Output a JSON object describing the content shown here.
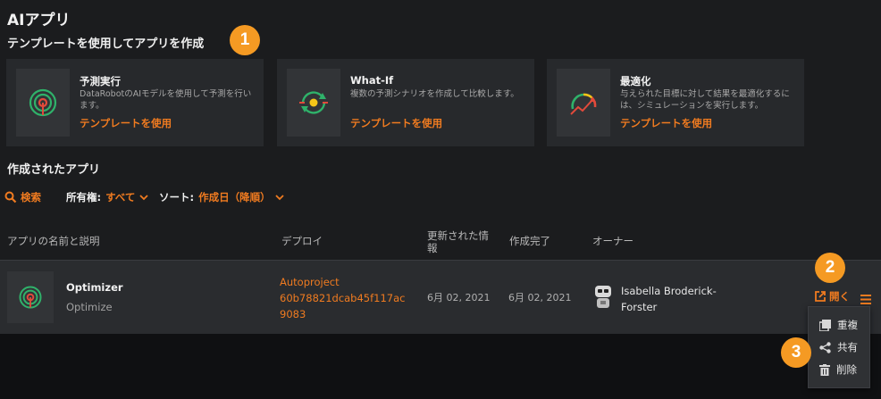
{
  "page": {
    "title": "AIアプリ"
  },
  "templates": {
    "heading": "テンプレートを使用してアプリを作成",
    "cards": [
      {
        "title": "予測実行",
        "description": "DataRobotのAIモデルを使用して予測を行います。",
        "link": "テンプレートを使用",
        "icon": "target-icon"
      },
      {
        "title": "What-If",
        "description": "複数の予測シナリオを作成して比較します。",
        "link": "テンプレートを使用",
        "icon": "cycle-icon"
      },
      {
        "title": "最適化",
        "description": "与えられた目標に対して結果を最適化するには、シミュレーションを実行します。",
        "link": "テンプレートを使用",
        "icon": "gauge-icon"
      }
    ]
  },
  "created": {
    "heading": "作成されたアプリ",
    "search_label": "検索",
    "ownership_label": "所有権:",
    "ownership_value": "すべて",
    "sort_label": "ソート:",
    "sort_value": "作成日（降順）"
  },
  "table": {
    "columns": [
      "アプリの名前と説明",
      "デプロイ",
      "更新された情報",
      "作成完了",
      "オーナー"
    ],
    "rows": [
      {
        "name": "Optimizer",
        "description": "Optimize",
        "deploy_line1": "Autoproject",
        "deploy_line2": "60b78821dcab45f117ac",
        "deploy_line3": "9083",
        "updated": "6月 02, 2021",
        "created": "6月 02, 2021",
        "owner_line1": "Isabella Broderick-",
        "owner_line2": "Forster",
        "open_label": "開く"
      }
    ]
  },
  "menu": {
    "items": [
      "重複",
      "共有",
      "削除"
    ]
  },
  "callouts": [
    "1",
    "2",
    "3"
  ],
  "colors": {
    "accent": "#f07b20",
    "callout": "#f59a23",
    "background": "#1b1c1e",
    "card": "#27292c"
  }
}
